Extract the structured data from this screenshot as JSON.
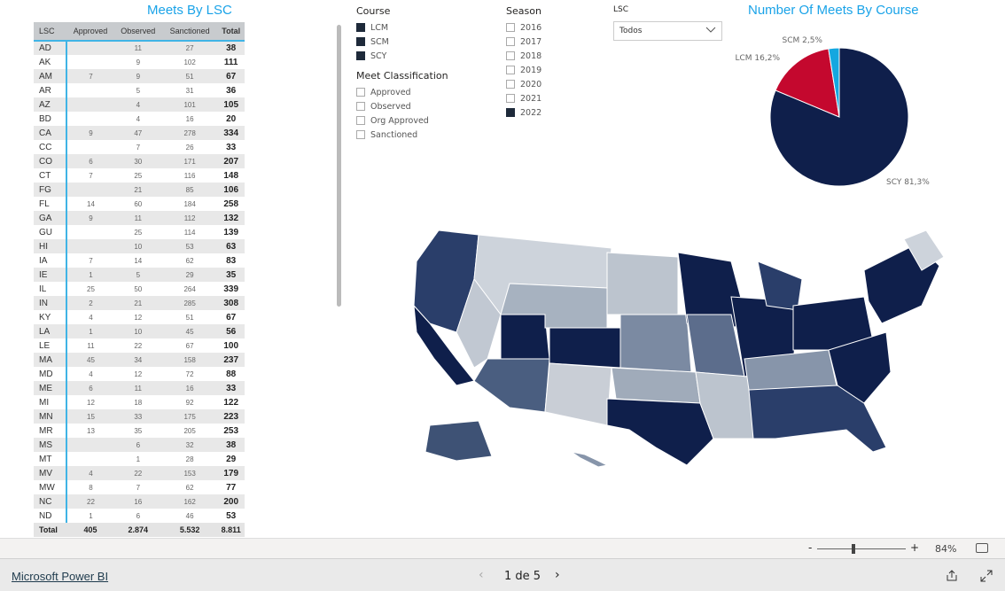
{
  "table": {
    "title": "Meets By LSC",
    "columns": [
      "LSC",
      "Approved",
      "Observed",
      "Sanctioned",
      "Total"
    ],
    "rows": [
      [
        "AD",
        "",
        "11",
        "27",
        "38"
      ],
      [
        "AK",
        "",
        "9",
        "102",
        "111"
      ],
      [
        "AM",
        "7",
        "9",
        "51",
        "67"
      ],
      [
        "AR",
        "",
        "5",
        "31",
        "36"
      ],
      [
        "AZ",
        "",
        "4",
        "101",
        "105"
      ],
      [
        "BD",
        "",
        "4",
        "16",
        "20"
      ],
      [
        "CA",
        "9",
        "47",
        "278",
        "334"
      ],
      [
        "CC",
        "",
        "7",
        "26",
        "33"
      ],
      [
        "CO",
        "6",
        "30",
        "171",
        "207"
      ],
      [
        "CT",
        "7",
        "25",
        "116",
        "148"
      ],
      [
        "FG",
        "",
        "21",
        "85",
        "106"
      ],
      [
        "FL",
        "14",
        "60",
        "184",
        "258"
      ],
      [
        "GA",
        "9",
        "11",
        "112",
        "132"
      ],
      [
        "GU",
        "",
        "25",
        "114",
        "139"
      ],
      [
        "HI",
        "",
        "10",
        "53",
        "63"
      ],
      [
        "IA",
        "7",
        "14",
        "62",
        "83"
      ],
      [
        "IE",
        "1",
        "5",
        "29",
        "35"
      ],
      [
        "IL",
        "25",
        "50",
        "264",
        "339"
      ],
      [
        "IN",
        "2",
        "21",
        "285",
        "308"
      ],
      [
        "KY",
        "4",
        "12",
        "51",
        "67"
      ],
      [
        "LA",
        "1",
        "10",
        "45",
        "56"
      ],
      [
        "LE",
        "11",
        "22",
        "67",
        "100"
      ],
      [
        "MA",
        "45",
        "34",
        "158",
        "237"
      ],
      [
        "MD",
        "4",
        "12",
        "72",
        "88"
      ],
      [
        "ME",
        "6",
        "11",
        "16",
        "33"
      ],
      [
        "MI",
        "12",
        "18",
        "92",
        "122"
      ],
      [
        "MN",
        "15",
        "33",
        "175",
        "223"
      ],
      [
        "MR",
        "13",
        "35",
        "205",
        "253"
      ],
      [
        "MS",
        "",
        "6",
        "32",
        "38"
      ],
      [
        "MT",
        "",
        "1",
        "28",
        "29"
      ],
      [
        "MV",
        "4",
        "22",
        "153",
        "179"
      ],
      [
        "MW",
        "8",
        "7",
        "62",
        "77"
      ],
      [
        "NC",
        "22",
        "16",
        "162",
        "200"
      ],
      [
        "ND",
        "1",
        "6",
        "46",
        "53"
      ]
    ],
    "total": [
      "Total",
      "405",
      "2.874",
      "5.532",
      "8.811"
    ]
  },
  "course": {
    "label": "Course",
    "options": [
      {
        "label": "LCM",
        "checked": true
      },
      {
        "label": "SCM",
        "checked": true
      },
      {
        "label": "SCY",
        "checked": true
      }
    ]
  },
  "classification": {
    "label": "Meet Classification",
    "options": [
      {
        "label": "Approved",
        "checked": false
      },
      {
        "label": "Observed",
        "checked": false
      },
      {
        "label": "Org Approved",
        "checked": false
      },
      {
        "label": "Sanctioned",
        "checked": false
      }
    ]
  },
  "season": {
    "label": "Season",
    "options": [
      {
        "label": "2016",
        "checked": false
      },
      {
        "label": "2017",
        "checked": false
      },
      {
        "label": "2018",
        "checked": false
      },
      {
        "label": "2019",
        "checked": false
      },
      {
        "label": "2020",
        "checked": false
      },
      {
        "label": "2021",
        "checked": false
      },
      {
        "label": "2022",
        "checked": true
      }
    ]
  },
  "lsc": {
    "label": "LSC",
    "value": "Todos"
  },
  "pie": {
    "title": "Number Of Meets By Course",
    "slices": [
      {
        "label": "SCY 81,3%",
        "value": 81.3,
        "color": "#0f1f4b"
      },
      {
        "label": "LCM 16,2%",
        "value": 16.2,
        "color": "#c4082e"
      },
      {
        "label": "SCM 2,5%",
        "value": 2.5,
        "color": "#14a7e0"
      }
    ]
  },
  "zoom": {
    "minus": "-",
    "plus": "+",
    "level": "84%"
  },
  "footer": {
    "brand": "Microsoft Power BI",
    "page": "1 de 5"
  }
}
